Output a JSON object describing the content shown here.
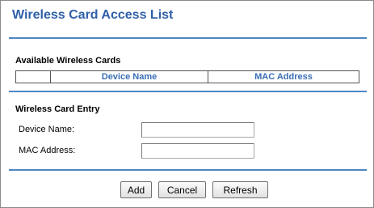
{
  "page": {
    "title": "Wireless Card Access List"
  },
  "available_cards": {
    "heading": "Available Wireless Cards",
    "columns": [
      "",
      "Device Name",
      "MAC Address"
    ]
  },
  "entry": {
    "heading": "Wireless Card Entry",
    "device_name_label": "Device Name:",
    "device_name_value": "",
    "mac_address_label": "MAC Address:",
    "mac_address_value": ""
  },
  "buttons": {
    "add": "Add",
    "cancel": "Cancel",
    "refresh": "Refresh"
  },
  "colors": {
    "title": "#2f5fa8",
    "rule": "#4f86c6",
    "column_header": "#3a6fb5"
  }
}
